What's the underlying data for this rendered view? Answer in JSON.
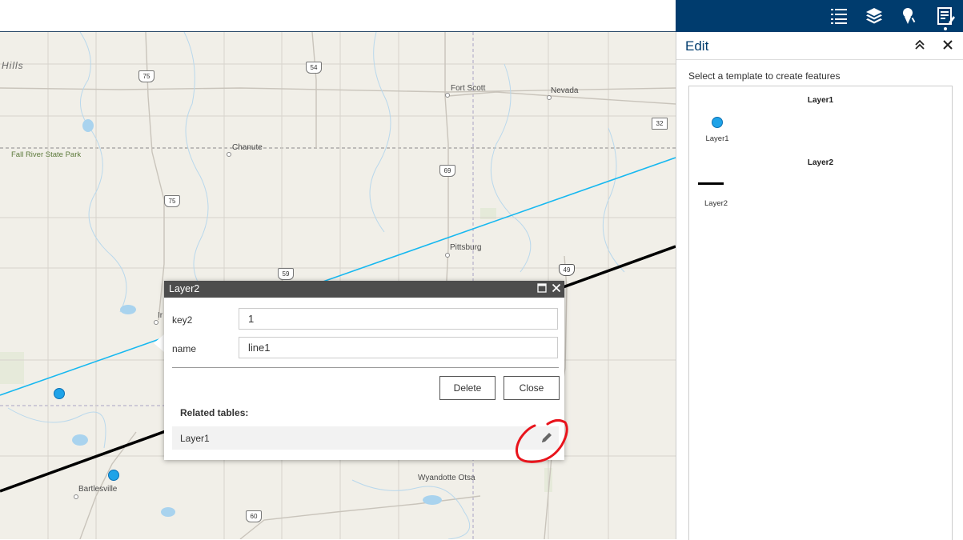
{
  "map": {
    "places": [
      "Fort Scott",
      "Nevada",
      "Chanute",
      "Pittsburg",
      "Bartlesville",
      "Wyandotte Otsa",
      "Ir"
    ],
    "park_label": "Fall River State Park",
    "region_label": "Hills",
    "shields": [
      "75",
      "54",
      "75",
      "69",
      "32",
      "59",
      "49",
      "60"
    ]
  },
  "appbar": {
    "icons": [
      "list-icon",
      "layers-icon",
      "draw-icon",
      "edit-icon"
    ]
  },
  "edit_panel": {
    "title": "Edit",
    "hint": "Select a template to create features",
    "groups": [
      {
        "name": "Layer1",
        "item_label": "Layer1",
        "symbol": "point"
      },
      {
        "name": "Layer2",
        "item_label": "Layer2",
        "symbol": "line"
      }
    ]
  },
  "popup": {
    "title": "Layer2",
    "fields": [
      {
        "label": "key2",
        "value": "1"
      },
      {
        "label": "name",
        "value": "line1"
      }
    ],
    "delete_label": "Delete",
    "close_label": "Close",
    "related_heading": "Related tables:",
    "related_item": "Layer1"
  },
  "colors": {
    "appbar": "#003c6e",
    "popup_header": "#4d4d4d",
    "point_fill": "#1fa3e8",
    "cyan_line": "#17b8f0",
    "annotation_red": "#e8141c"
  }
}
